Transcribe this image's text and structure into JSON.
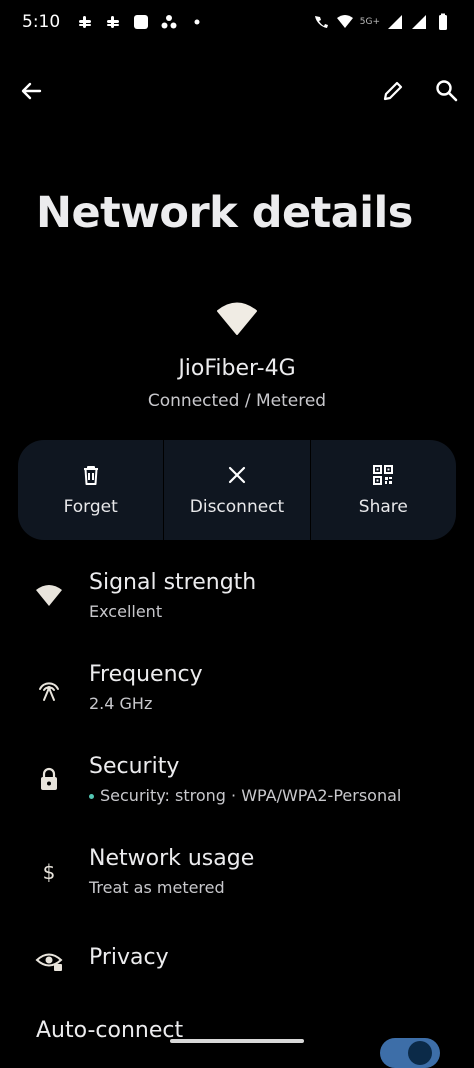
{
  "status_bar": {
    "time": "5:10",
    "network_label": "5G+"
  },
  "page": {
    "title": "Network details"
  },
  "network": {
    "name": "JioFiber-4G",
    "status": "Connected / Metered"
  },
  "actions": [
    {
      "label": "Forget",
      "icon": "trash-icon"
    },
    {
      "label": "Disconnect",
      "icon": "close-icon"
    },
    {
      "label": "Share",
      "icon": "qr-code-icon"
    }
  ],
  "details": {
    "signal": {
      "title": "Signal strength",
      "value": "Excellent"
    },
    "frequency": {
      "title": "Frequency",
      "value": "2.4 GHz"
    },
    "security": {
      "title": "Security",
      "value": "Security: strong · WPA/WPA2-Personal"
    },
    "usage": {
      "title": "Network usage",
      "value": "Treat as metered"
    },
    "privacy": {
      "title": "Privacy"
    },
    "auto_connect": {
      "title": "Auto-connect",
      "enabled": true
    }
  },
  "colors": {
    "background": "#000000",
    "card": "#0f1620",
    "accent_dot": "#54c7b4",
    "toggle_on": "#3d6ea8"
  }
}
